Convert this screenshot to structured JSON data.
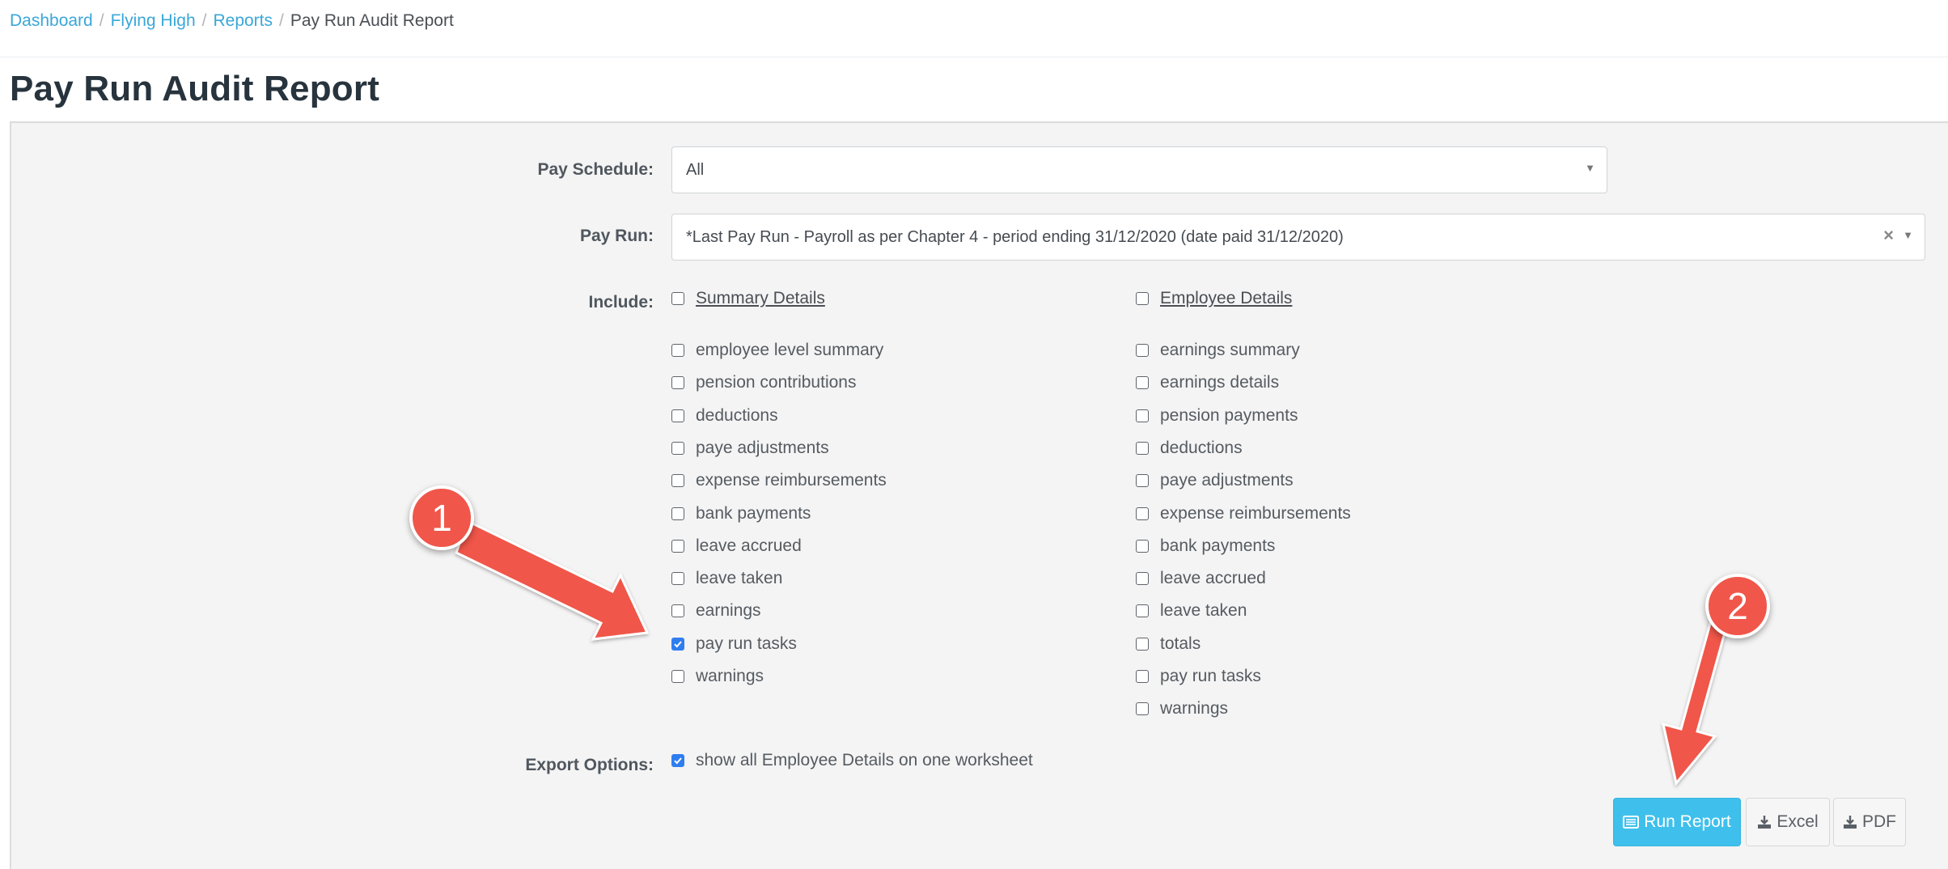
{
  "breadcrumb": {
    "items": [
      "Dashboard",
      "Flying High",
      "Reports"
    ],
    "separator": "/",
    "current": "Pay Run Audit Report"
  },
  "page": {
    "title": "Pay Run Audit Report"
  },
  "form": {
    "pay_schedule": {
      "label": "Pay Schedule:",
      "value": "All"
    },
    "pay_run": {
      "label": "Pay Run:",
      "value": "*Last Pay Run - Payroll as per Chapter 4 - period ending 31/12/2020 (date paid 31/12/2020)",
      "clear_glyph": "×"
    },
    "include": {
      "label": "Include:",
      "summary": {
        "header": {
          "label": "Summary Details",
          "checked": false
        },
        "items": [
          {
            "label": "employee level summary",
            "checked": false
          },
          {
            "label": "pension contributions",
            "checked": false
          },
          {
            "label": "deductions",
            "checked": false
          },
          {
            "label": "paye adjustments",
            "checked": false
          },
          {
            "label": "expense reimbursements",
            "checked": false
          },
          {
            "label": "bank payments",
            "checked": false
          },
          {
            "label": "leave accrued",
            "checked": false
          },
          {
            "label": "leave taken",
            "checked": false
          },
          {
            "label": "earnings",
            "checked": false
          },
          {
            "label": "pay run tasks",
            "checked": true
          },
          {
            "label": "warnings",
            "checked": false
          }
        ]
      },
      "employee": {
        "header": {
          "label": "Employee Details",
          "checked": false
        },
        "items": [
          {
            "label": "earnings summary",
            "checked": false
          },
          {
            "label": "earnings details",
            "checked": false
          },
          {
            "label": "pension payments",
            "checked": false
          },
          {
            "label": "deductions",
            "checked": false
          },
          {
            "label": "paye adjustments",
            "checked": false
          },
          {
            "label": "expense reimbursements",
            "checked": false
          },
          {
            "label": "bank payments",
            "checked": false
          },
          {
            "label": "leave accrued",
            "checked": false
          },
          {
            "label": "leave taken",
            "checked": false
          },
          {
            "label": "totals",
            "checked": false
          },
          {
            "label": "pay run tasks",
            "checked": false
          },
          {
            "label": "warnings",
            "checked": false
          }
        ]
      }
    },
    "export_options": {
      "label": "Export Options:",
      "item": {
        "label": "show all Employee Details on one worksheet",
        "checked": true
      }
    }
  },
  "buttons": {
    "run_report": {
      "label": "Run Report",
      "icon": "report-icon"
    },
    "excel": {
      "label": "Excel",
      "icon": "download-icon"
    },
    "pdf": {
      "label": "PDF",
      "icon": "download-icon"
    }
  },
  "annotations": {
    "marker1": "1",
    "marker2": "2",
    "color": "#f0564a"
  },
  "colors": {
    "link": "#3aa7d8",
    "primary_button": "#3fc0ec",
    "checkbox_checked": "#2f7ef0",
    "panel_background": "#f4f4f4",
    "title": "#27333d"
  }
}
